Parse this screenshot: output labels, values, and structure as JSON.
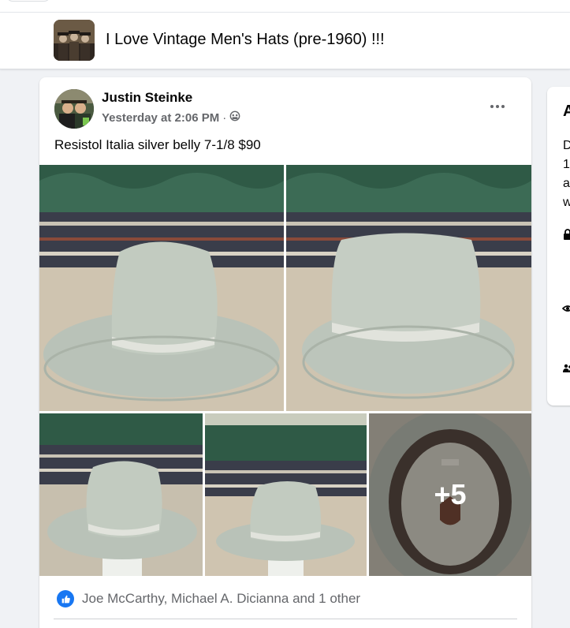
{
  "group": {
    "title": "I Love Vintage Men's Hats (pre-1960) !!!"
  },
  "post": {
    "author": "Justin Steinke",
    "timestamp": "Yesterday at 2:06 PM",
    "separator": "·",
    "audience_icon": "group-audience-icon",
    "text": "Resistol Italia silver belly 7-1/8 $90",
    "more_photos_label": "+5",
    "reactions_text": "Joe McCarthy, Michael A. Dicianna and 1 other"
  },
  "sidebar": {
    "title_fragment": "A",
    "line_fragments": [
      "D",
      "1",
      "a",
      "w"
    ]
  },
  "colors": {
    "brand_blue": "#1877f2",
    "secondary_text": "#65676b",
    "page_background": "#f0f2f5"
  }
}
